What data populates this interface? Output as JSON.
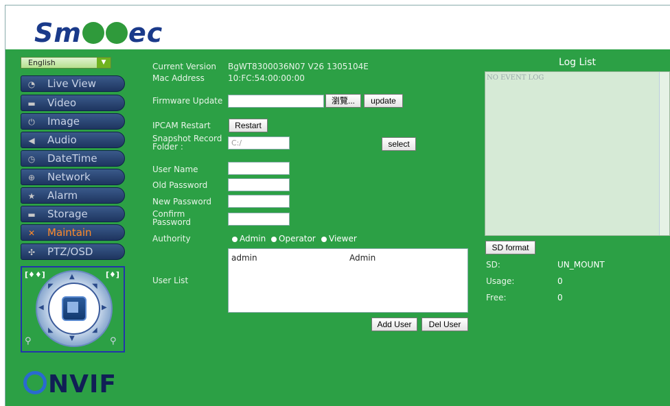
{
  "header": {
    "logo_text_left": "Sm",
    "logo_text_right": "ec"
  },
  "language": {
    "selected": "English"
  },
  "nav": [
    {
      "label": "Live View",
      "icon": "chat-icon"
    },
    {
      "label": "Video",
      "icon": "camera-icon"
    },
    {
      "label": "Image",
      "icon": "power-icon"
    },
    {
      "label": "Audio",
      "icon": "speaker-icon"
    },
    {
      "label": "DateTime",
      "icon": "clock-icon"
    },
    {
      "label": "Network",
      "icon": "globe-icon"
    },
    {
      "label": "Alarm",
      "icon": "alarm-icon"
    },
    {
      "label": "Storage",
      "icon": "disk-icon"
    },
    {
      "label": "Maintain",
      "icon": "tools-icon",
      "active": true
    },
    {
      "label": "PTZ/OSD",
      "icon": "ptz-icon"
    }
  ],
  "ptz": {
    "iris_label": "[♦♦]",
    "focus_label": "[♦]"
  },
  "onvif": {
    "text": "NVIF"
  },
  "form": {
    "current_version_label": "Current Version",
    "current_version": "BgWT8300036N07 V26 1305104E",
    "mac_label": "Mac Address",
    "mac": "10:FC:54:00:00:00",
    "firmware_label": "Firmware Update",
    "browse_label": "瀏覽...",
    "update_label": "update",
    "restart_label": "IPCAM Restart",
    "restart_button": "Restart",
    "snapshot_label_1": "Snapshot Record",
    "snapshot_label_2": "Folder :",
    "snapshot_value": "C:/",
    "select_label": "select",
    "user_name_label": "User Name",
    "old_password_label": "Old Password",
    "new_password_label": "New Password",
    "confirm_label_1": "Confirm",
    "confirm_label_2": "Password",
    "authority_label": "Authority",
    "authority_options": [
      "Admin",
      "Operator",
      "Viewer"
    ],
    "user_list_label": "User List",
    "users": [
      {
        "name": "admin",
        "role": "Admin"
      }
    ],
    "add_user_label": "Add User",
    "del_user_label": "Del User"
  },
  "log": {
    "title": "Log List",
    "content": "NO EVENT LOG",
    "sd_format_label": "SD format",
    "sd_label": "SD:",
    "sd_value": "UN_MOUNT",
    "usage_label": "Usage:",
    "usage_value": "0",
    "free_label": "Free:",
    "free_value": "0"
  },
  "colors": {
    "background": "#2ca045",
    "nav": "#1e3560",
    "active": "#ff8a2a"
  }
}
